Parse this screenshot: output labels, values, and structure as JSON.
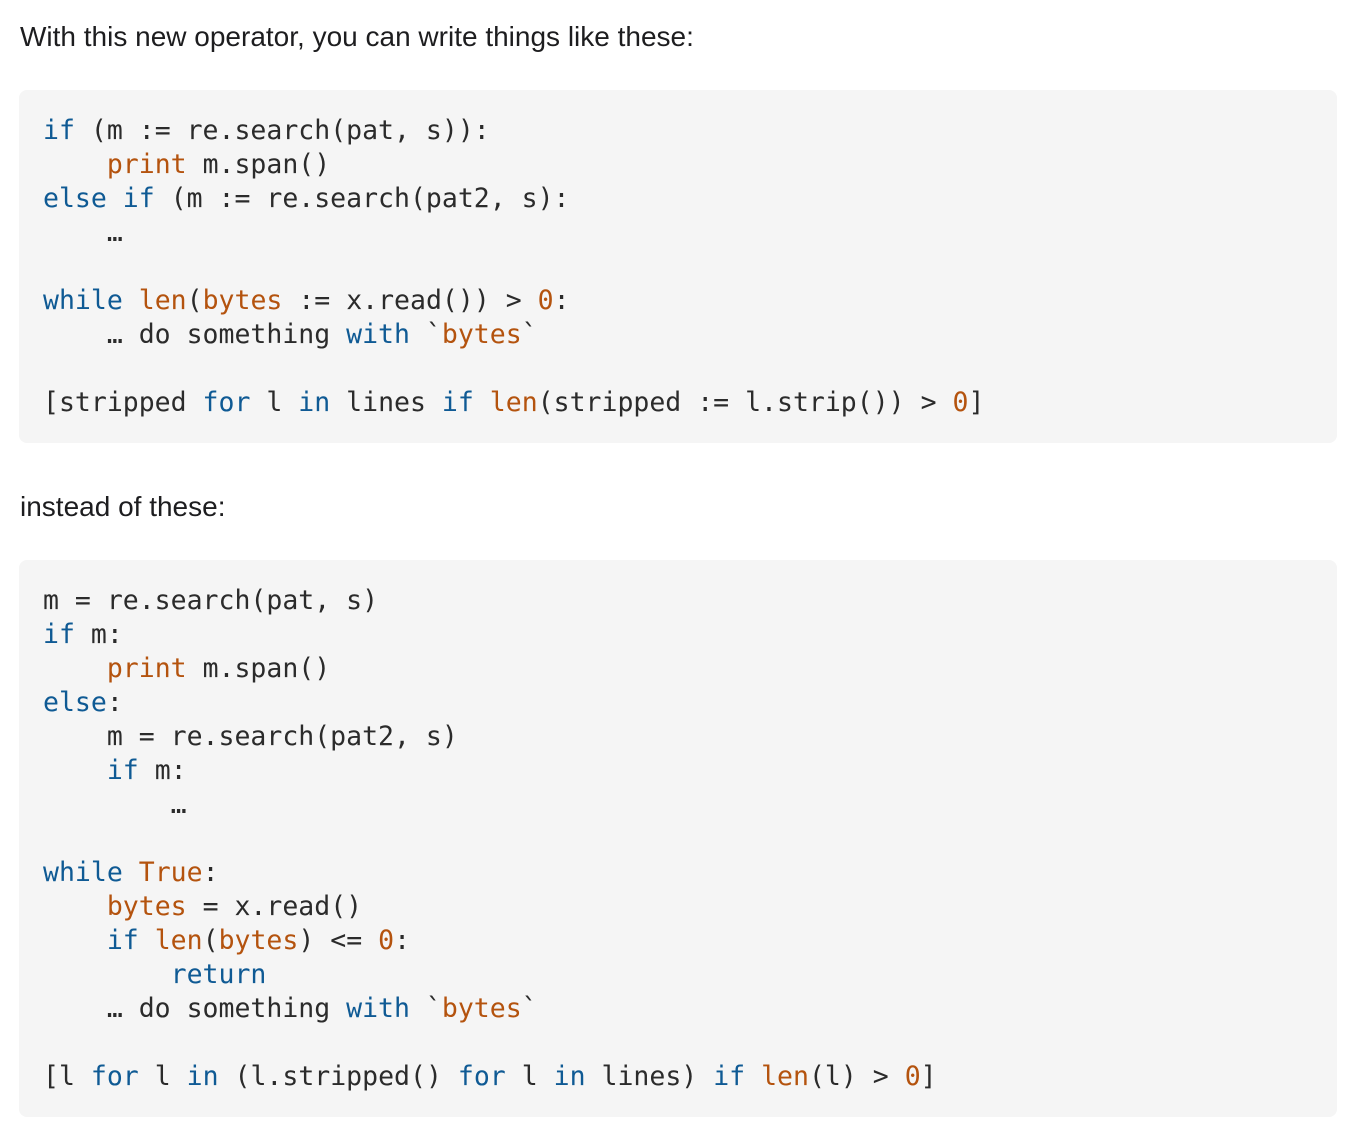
{
  "para1": "With this new operator, you can write things like these:",
  "para2": "instead of these:",
  "block1": [
    [
      [
        "if",
        "k"
      ],
      [
        " (m := re.search(pat, s)):",
        ""
      ]
    ],
    [
      [
        "    ",
        ""
      ],
      [
        "print",
        "o"
      ],
      [
        " m.span()",
        ""
      ]
    ],
    [
      [
        "else if",
        "k"
      ],
      [
        " (m := re.search(pat2, s):",
        ""
      ]
    ],
    [
      [
        "    …",
        ""
      ]
    ],
    [],
    [
      [
        "while",
        "k"
      ],
      [
        " ",
        ""
      ],
      [
        "len",
        "o"
      ],
      [
        "(",
        ""
      ],
      [
        "bytes",
        "o"
      ],
      [
        " := x.read()) > ",
        ""
      ],
      [
        "0",
        "o"
      ],
      [
        ":",
        ""
      ]
    ],
    [
      [
        "    … do something ",
        ""
      ],
      [
        "with",
        "k"
      ],
      [
        " `",
        ""
      ],
      [
        "bytes",
        "o"
      ],
      [
        "`",
        ""
      ]
    ],
    [],
    [
      [
        "[stripped ",
        ""
      ],
      [
        "for",
        "k"
      ],
      [
        " l ",
        ""
      ],
      [
        "in",
        "k"
      ],
      [
        " lines ",
        ""
      ],
      [
        "if",
        "k"
      ],
      [
        " ",
        ""
      ],
      [
        "len",
        "o"
      ],
      [
        "(stripped := l.strip()) > ",
        ""
      ],
      [
        "0",
        "o"
      ],
      [
        "]",
        ""
      ]
    ]
  ],
  "block2": [
    [
      [
        "m = re.search(pat, s)",
        ""
      ]
    ],
    [
      [
        "if",
        "k"
      ],
      [
        " m:",
        ""
      ]
    ],
    [
      [
        "    ",
        ""
      ],
      [
        "print",
        "o"
      ],
      [
        " m.span()",
        ""
      ]
    ],
    [
      [
        "else",
        "k"
      ],
      [
        ":",
        ""
      ]
    ],
    [
      [
        "    m = re.search(pat2, s)",
        ""
      ]
    ],
    [
      [
        "    ",
        ""
      ],
      [
        "if",
        "k"
      ],
      [
        " m:",
        ""
      ]
    ],
    [
      [
        "        …",
        ""
      ]
    ],
    [],
    [
      [
        "while",
        "k"
      ],
      [
        " ",
        ""
      ],
      [
        "True",
        "o"
      ],
      [
        ":",
        ""
      ]
    ],
    [
      [
        "    ",
        ""
      ],
      [
        "bytes",
        "o"
      ],
      [
        " = x.read()",
        ""
      ]
    ],
    [
      [
        "    ",
        ""
      ],
      [
        "if",
        "k"
      ],
      [
        " ",
        ""
      ],
      [
        "len",
        "o"
      ],
      [
        "(",
        ""
      ],
      [
        "bytes",
        "o"
      ],
      [
        ") <= ",
        ""
      ],
      [
        "0",
        "o"
      ],
      [
        ":",
        ""
      ]
    ],
    [
      [
        "        ",
        ""
      ],
      [
        "return",
        "k"
      ]
    ],
    [
      [
        "    … do something ",
        ""
      ],
      [
        "with",
        "k"
      ],
      [
        " `",
        ""
      ],
      [
        "bytes",
        "o"
      ],
      [
        "`",
        ""
      ]
    ],
    [],
    [
      [
        "[l ",
        ""
      ],
      [
        "for",
        "k"
      ],
      [
        " l ",
        ""
      ],
      [
        "in",
        "k"
      ],
      [
        " (l.stripped() ",
        ""
      ],
      [
        "for",
        "k"
      ],
      [
        " l ",
        ""
      ],
      [
        "in",
        "k"
      ],
      [
        " lines) ",
        ""
      ],
      [
        "if",
        "k"
      ],
      [
        " ",
        ""
      ],
      [
        "len",
        "o"
      ],
      [
        "(l) > ",
        ""
      ],
      [
        "0",
        "o"
      ],
      [
        "]",
        ""
      ]
    ]
  ]
}
